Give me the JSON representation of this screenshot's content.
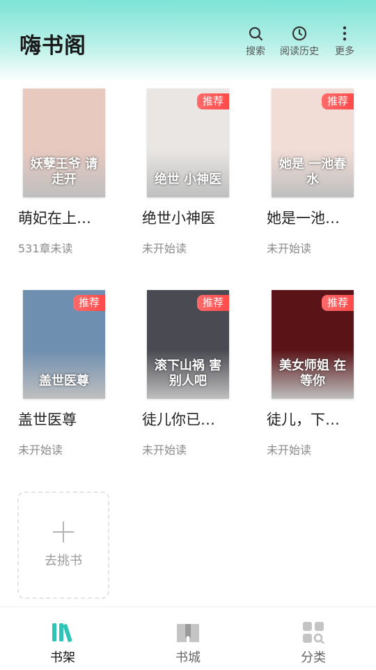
{
  "header": {
    "title": "嗨书阁",
    "actions": [
      {
        "label": "搜索",
        "icon": "search-icon"
      },
      {
        "label": "阅读历史",
        "icon": "history-icon"
      },
      {
        "label": "更多",
        "icon": "more-icon"
      }
    ]
  },
  "books": [
    {
      "title": "萌妃在上…",
      "progress": "531章未读",
      "badge": "",
      "cover_text": "妖孽王爷 请走开",
      "cover_color": "#e8c9c0"
    },
    {
      "title": "绝世小神医",
      "progress": "未开始读",
      "badge": "推荐",
      "cover_text": "绝世 小神医",
      "cover_color": "#e9e6e3"
    },
    {
      "title": "她是一池…",
      "progress": "未开始读",
      "badge": "推荐",
      "cover_text": "她是 一池春水",
      "cover_color": "#f2ddd6"
    },
    {
      "title": "盖世医尊",
      "progress": "未开始读",
      "badge": "推荐",
      "cover_text": "盖世医尊",
      "cover_color": "#6f8fb0"
    },
    {
      "title": "徒儿你已…",
      "progress": "未开始读",
      "badge": "推荐",
      "cover_text": "滚下山祸 害别人吧",
      "cover_color": "#4a4a52"
    },
    {
      "title": "徒儿，下…",
      "progress": "未开始读",
      "badge": "推荐",
      "cover_text": "美女师姐 在等你",
      "cover_color": "#5a1418"
    }
  ],
  "add_card": {
    "label": "去挑书"
  },
  "tabs": [
    {
      "label": "书架",
      "icon": "bookshelf-icon",
      "active": true
    },
    {
      "label": "书城",
      "icon": "book-store-icon",
      "active": false
    },
    {
      "label": "分类",
      "icon": "category-icon",
      "active": false
    }
  ],
  "colors": {
    "accent": "#2ec4b6",
    "badge": "#ff5252",
    "header_gradient": "#7de3d6"
  }
}
